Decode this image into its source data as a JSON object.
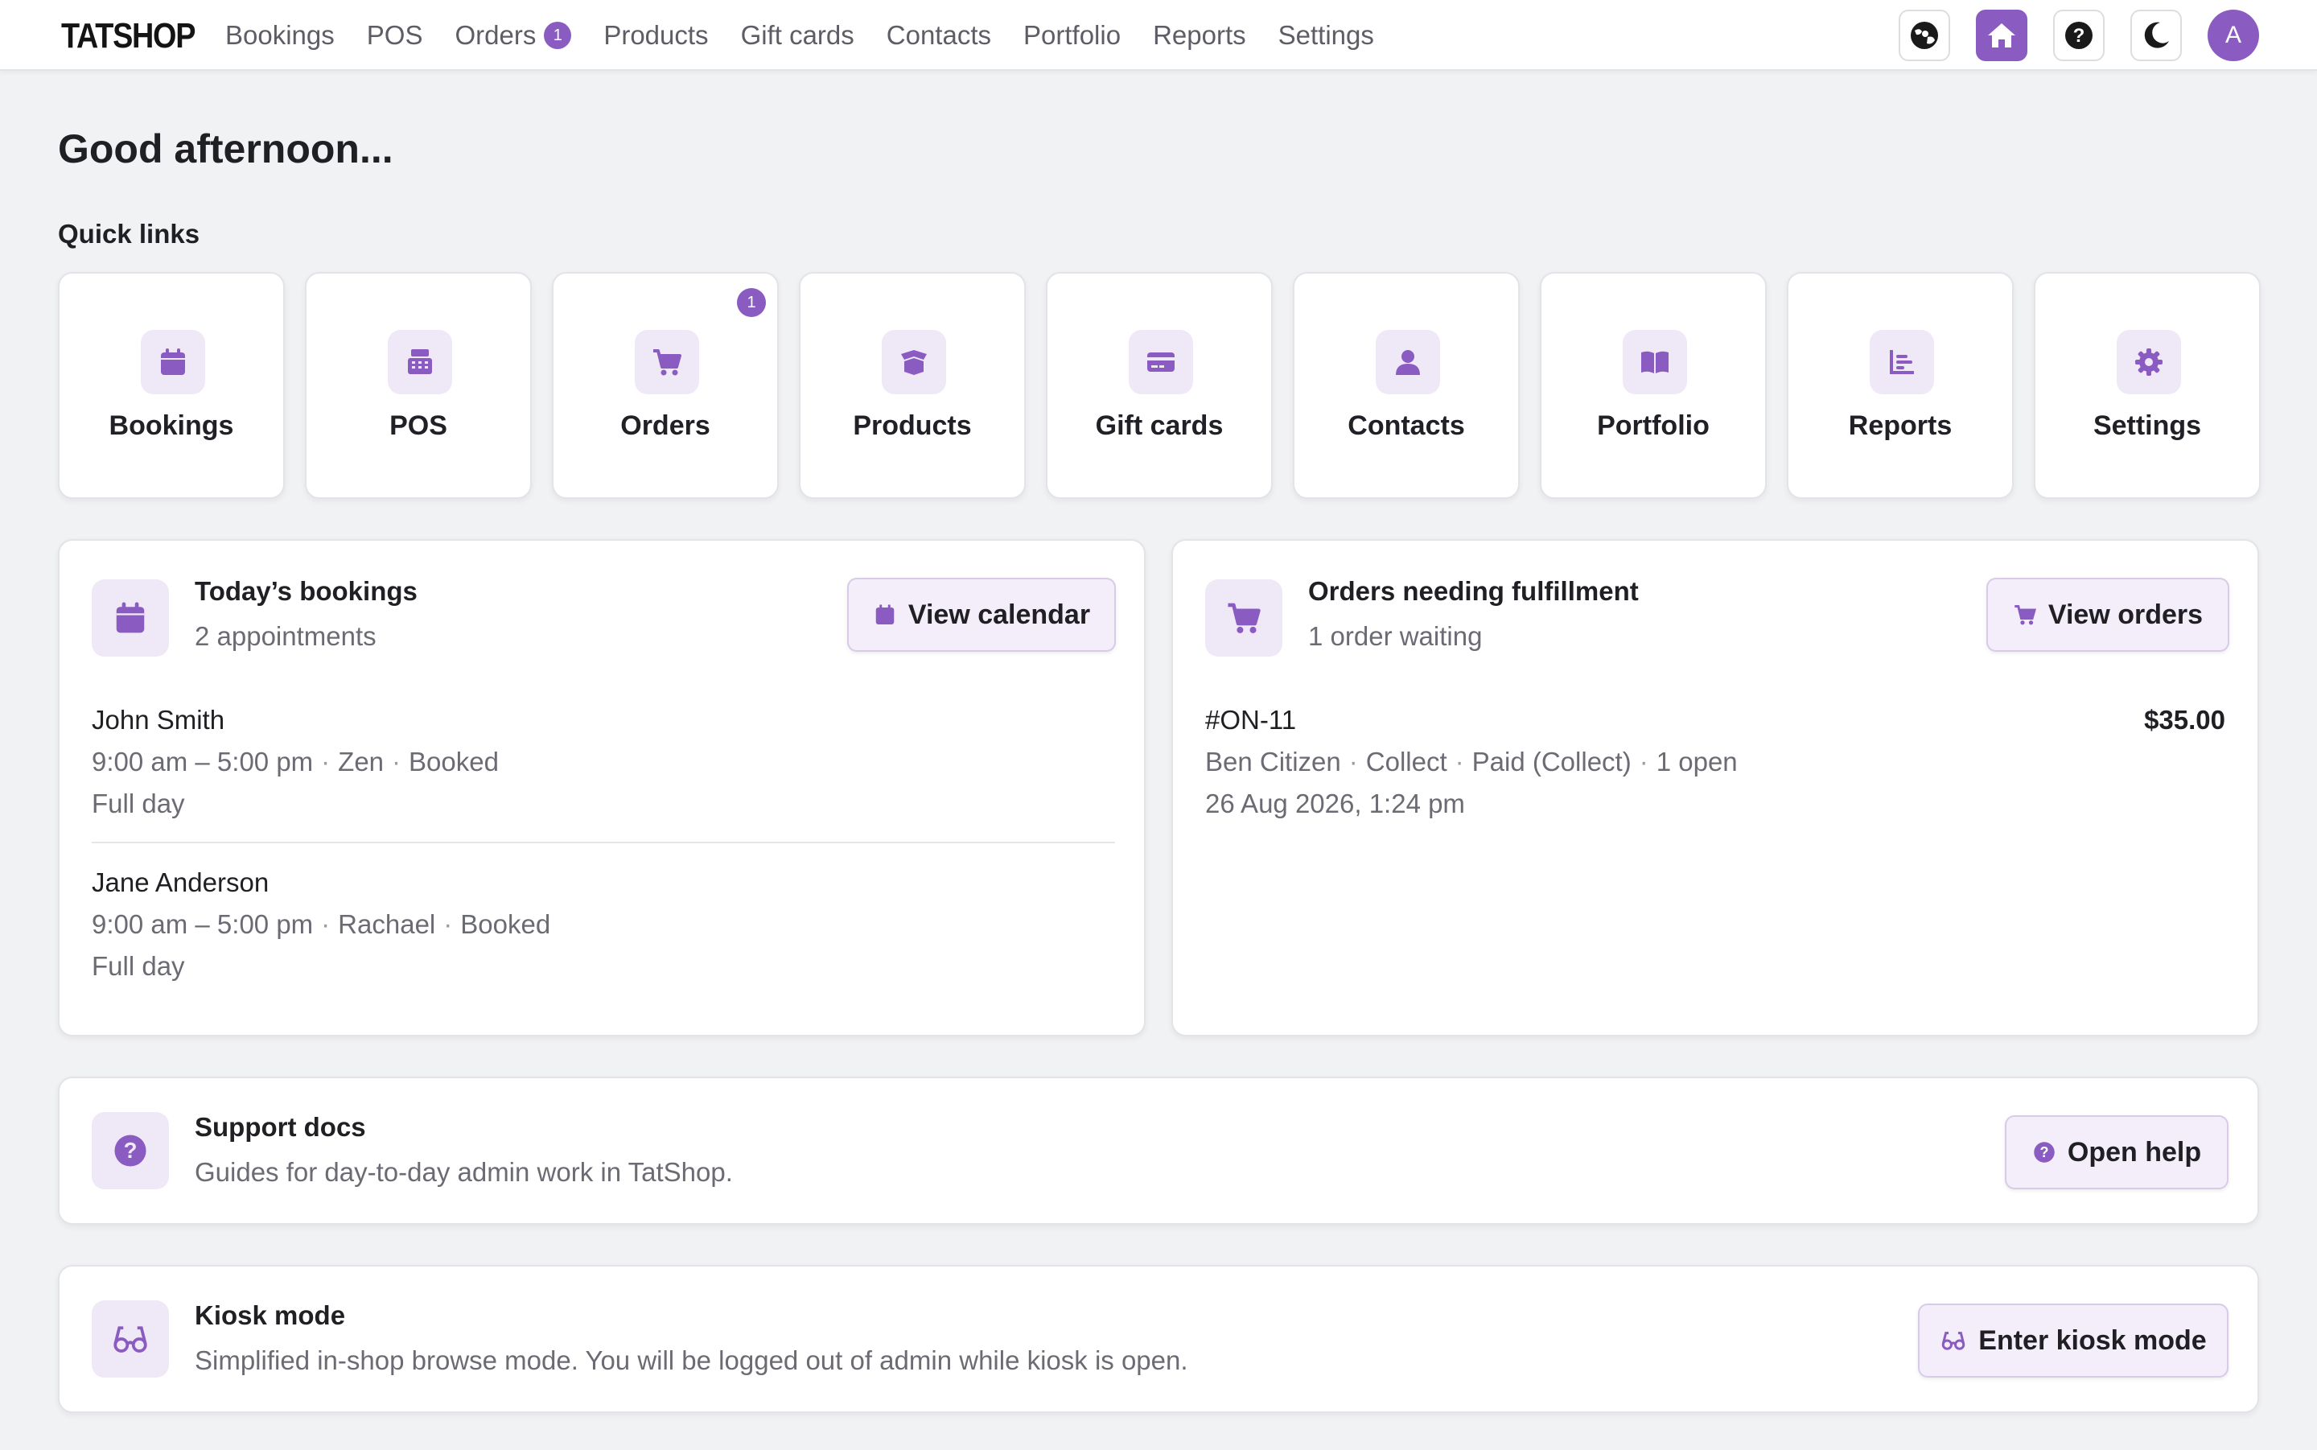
{
  "brand": {
    "name": "TATSHOP",
    "accent": "#8a5bc1"
  },
  "nav": {
    "items": [
      "Bookings",
      "POS",
      "Orders",
      "Products",
      "Gift cards",
      "Contacts",
      "Portfolio",
      "Reports",
      "Settings"
    ],
    "orders_badge": "1"
  },
  "topbar_icons": [
    "globe-user-icon",
    "home-icon",
    "help-icon",
    "moon-icon"
  ],
  "user": {
    "avatar_initial": "A"
  },
  "greeting": "Good afternoon...",
  "quick_links": {
    "title": "Quick links",
    "items": [
      {
        "label": "Bookings",
        "icon": "calendar-icon"
      },
      {
        "label": "POS",
        "icon": "cash-register-icon"
      },
      {
        "label": "Orders",
        "icon": "cart-icon",
        "badge": "1"
      },
      {
        "label": "Products",
        "icon": "box-icon"
      },
      {
        "label": "Gift cards",
        "icon": "credit-card-icon"
      },
      {
        "label": "Contacts",
        "icon": "user-icon"
      },
      {
        "label": "Portfolio",
        "icon": "book-icon"
      },
      {
        "label": "Reports",
        "icon": "bar-chart-icon"
      },
      {
        "label": "Settings",
        "icon": "gear-icon"
      }
    ]
  },
  "bookings_card": {
    "title": "Today’s bookings",
    "subtitle": "2 appointments",
    "button": "View calendar",
    "items": [
      {
        "name": "John Smith",
        "time": "9:00 am – 5:00 pm",
        "staff": "Zen",
        "status": "Booked",
        "duration": "Full day"
      },
      {
        "name": "Jane Anderson",
        "time": "9:00 am – 5:00 pm",
        "staff": "Rachael",
        "status": "Booked",
        "duration": "Full day"
      }
    ]
  },
  "orders_card": {
    "title": "Orders needing fulfillment",
    "subtitle": "1 order waiting",
    "button": "View orders",
    "items": [
      {
        "number": "#ON-11",
        "total": "$35.00",
        "customer": "Ben Citizen",
        "method": "Collect",
        "payment": "Paid (Collect)",
        "open": "1 open",
        "date": "26 Aug 2026, 1:24 pm"
      }
    ]
  },
  "support_card": {
    "title": "Support docs",
    "subtitle": "Guides for day-to-day admin work in TatShop.",
    "button": "Open help"
  },
  "kiosk_card": {
    "title": "Kiosk mode",
    "subtitle": "Simplified in-shop browse mode. You will be logged out of admin while kiosk is open.",
    "button": "Enter kiosk mode"
  }
}
